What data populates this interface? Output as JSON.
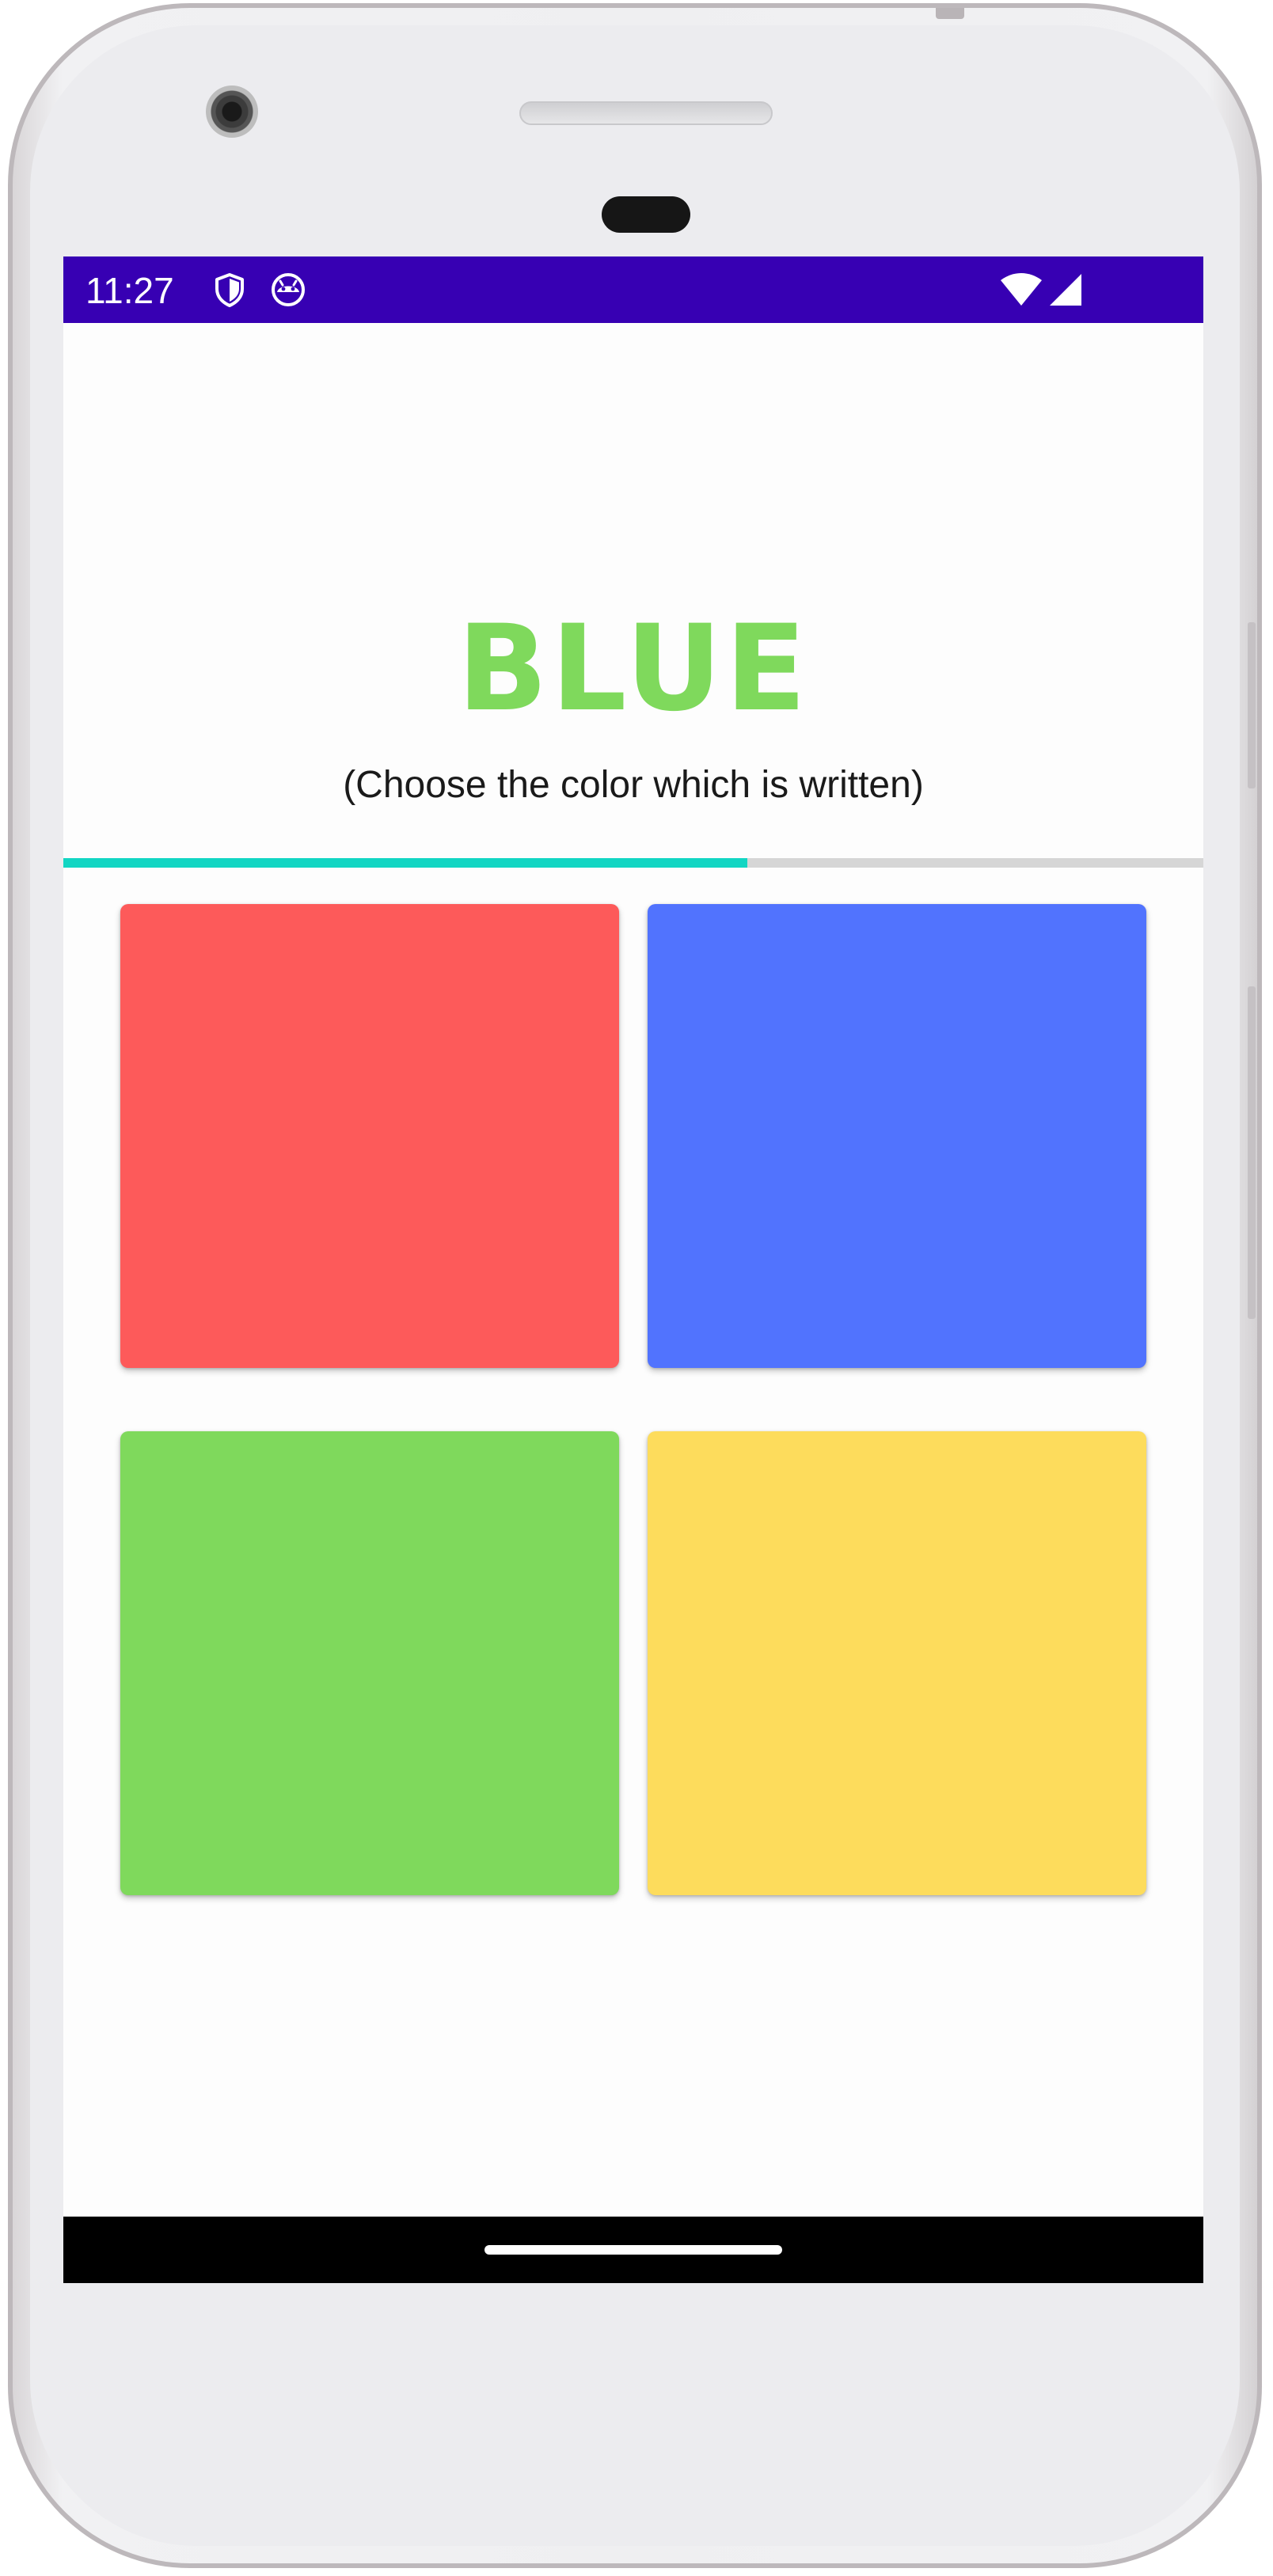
{
  "status_bar": {
    "time": "11:27",
    "icons_left": [
      "shield-icon",
      "android-face-icon"
    ],
    "icons_right": [
      "wifi-icon",
      "cell-signal-icon"
    ],
    "color": "#3700b3"
  },
  "game": {
    "color_word": "BLUE",
    "color_word_color": "#7fd95c",
    "instruction": "(Choose the color which is written)",
    "progress_fraction": 0.6,
    "progress_color": "#12d6c3",
    "options": [
      {
        "name": "red",
        "color": "#fd5a5a"
      },
      {
        "name": "blue",
        "color": "#5173fe"
      },
      {
        "name": "green",
        "color": "#7fd95c"
      },
      {
        "name": "yellow",
        "color": "#fddc5c"
      }
    ]
  }
}
